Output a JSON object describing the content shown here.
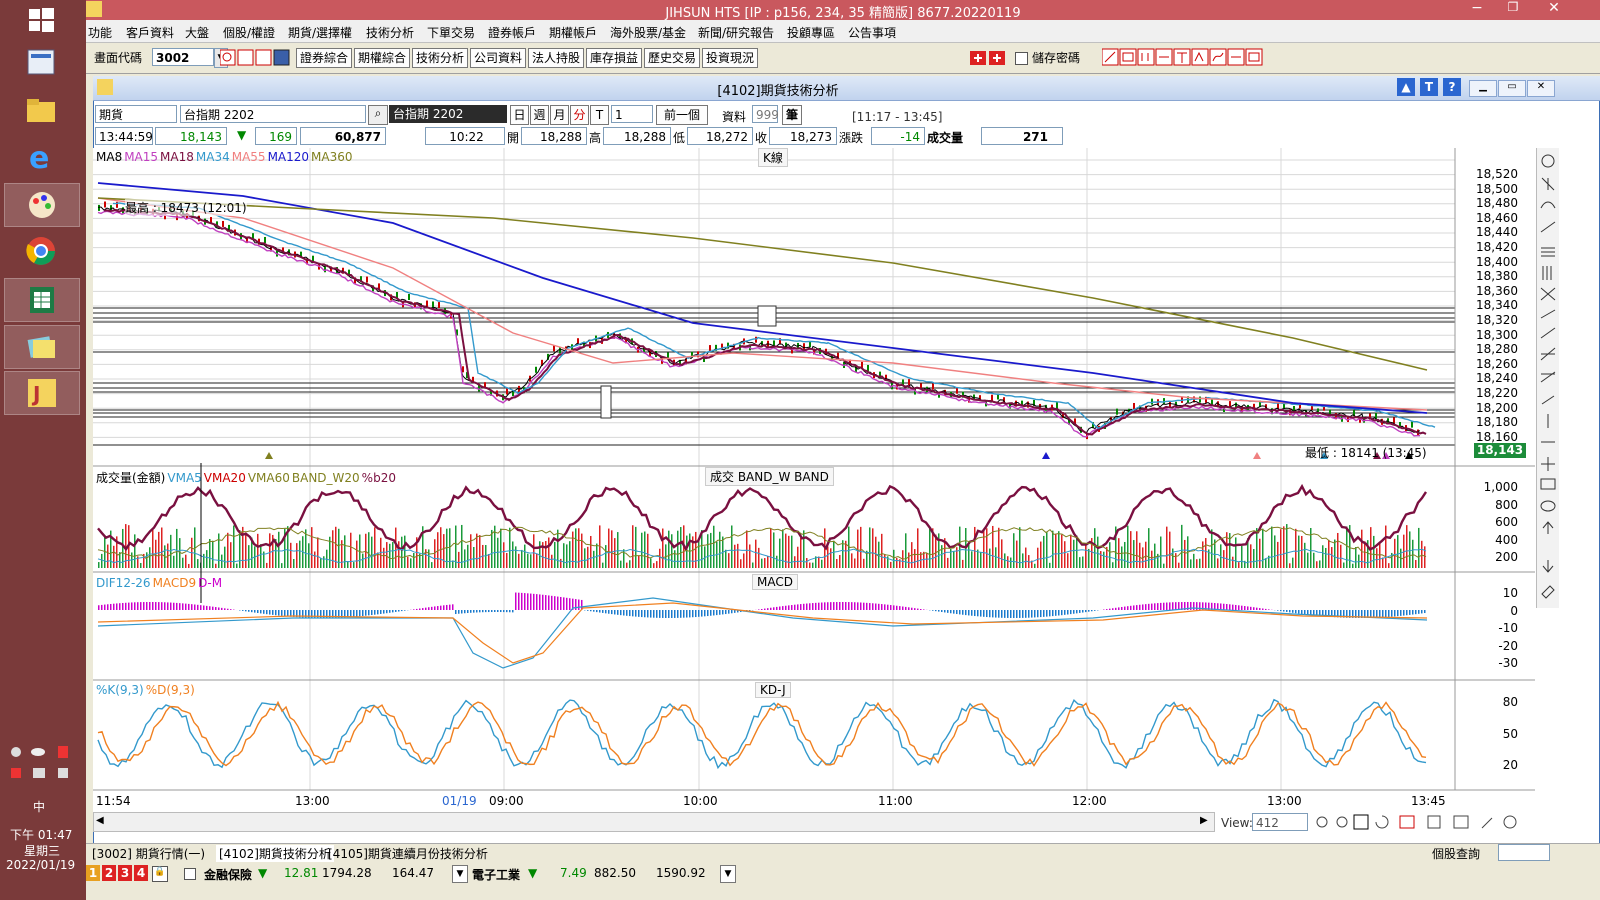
{
  "window": {
    "title": "JIHSUN HTS      [IP : p156, 234, 35 精簡版] 8677.20220119"
  },
  "menu": [
    "功能",
    "客戶資料",
    "大盤",
    "個股/權證",
    "期貨/選擇權",
    "技術分析",
    "下單交易",
    "證券帳戶",
    "期權帳戶",
    "海外股票/基金",
    "新聞/研究報告",
    "投顧專區",
    "公告事項"
  ],
  "toolbar": {
    "code_label": "畫面代碼",
    "code_value": "3002",
    "buttons": [
      "證券綜合",
      "期權綜合",
      "技術分析",
      "公司資料",
      "法人持股",
      "庫存損益",
      "歷史交易",
      "投資現況"
    ],
    "save_password": "儲存密碼"
  },
  "chart_window": {
    "title": "[4102]期貨技術分析",
    "product_type": "期貨",
    "product_name": "台指期 2202",
    "selected_product": "台指期 2202",
    "periods": [
      "日",
      "週",
      "月",
      "分",
      "T"
    ],
    "interval": "1",
    "prev_button": "前一個",
    "data_label": "資料",
    "data_count": "999",
    "count_unit": "筆",
    "session": "[11:17 - 13:45]",
    "view_label": "View:",
    "view_value": "412"
  },
  "quote": {
    "time": "13:44:59",
    "price": "18,143",
    "change_arrow": "▼",
    "change": "169",
    "volume_total": "60,877",
    "open_time": "10:22",
    "open_label": "開",
    "open": "18,288",
    "high_label": "高",
    "high": "18,288",
    "low_label": "低",
    "low": "18,272",
    "close_label": "收",
    "close": "18,273",
    "chg_label": "漲跌",
    "chg": "-14",
    "vol_label": "成交量",
    "vol": "271"
  },
  "panes": {
    "k": {
      "title": "K線",
      "legend": [
        {
          "name": "MA8",
          "color": "#000000"
        },
        {
          "name": "MA15",
          "color": "#c040c0"
        },
        {
          "name": "MA18",
          "color": "#7a1040"
        },
        {
          "name": "MA34",
          "color": "#3399cc"
        },
        {
          "name": "MA55",
          "color": "#f08080"
        },
        {
          "name": "MA120",
          "color": "#1a1acc"
        },
        {
          "name": "MA360",
          "color": "#808020"
        }
      ],
      "max_label": "最高 : 18473 (12:01)",
      "min_label": "最低 : 18141 (13:45)",
      "last_price": "18,143",
      "yticks": [
        "18,520",
        "18,500",
        "18,480",
        "18,460",
        "18,440",
        "18,420",
        "18,400",
        "18,380",
        "18,360",
        "18,340",
        "18,320",
        "18,300",
        "18,280",
        "18,260",
        "18,240",
        "18,220",
        "18,200",
        "18,180",
        "18,160"
      ]
    },
    "volume": {
      "title": "成交   BAND_W   BAND",
      "legend": [
        {
          "name": "成交量(金額)",
          "color": "#000000"
        },
        {
          "name": "VMA5",
          "color": "#3399cc"
        },
        {
          "name": "VMA20",
          "color": "#cc0000"
        },
        {
          "name": "VMA60",
          "color": "#808020"
        },
        {
          "name": "BAND_W20",
          "color": "#808020"
        },
        {
          "name": "%b20",
          "color": "#7a1040"
        }
      ],
      "yticks": [
        "1,000",
        "800",
        "600",
        "400",
        "200"
      ]
    },
    "macd": {
      "title": "MACD",
      "legend": [
        {
          "name": "DIF12-26",
          "color": "#3399cc"
        },
        {
          "name": "MACD9",
          "color": "#f08020"
        },
        {
          "name": "D-M",
          "color": "#cc00cc"
        }
      ],
      "yticks": [
        "10",
        "0",
        "-10",
        "-20",
        "-30"
      ]
    },
    "kd": {
      "title": "KD-J",
      "legend": [
        {
          "name": "%K(9,3)",
          "color": "#3399cc"
        },
        {
          "name": "%D(9,3)",
          "color": "#f08020"
        }
      ],
      "yticks": [
        "80",
        "50",
        "20"
      ]
    }
  },
  "xaxis": {
    "ticks": [
      "11:54",
      "13:00",
      "01/19",
      "09:00",
      "10:00",
      "11:00",
      "12:00",
      "13:00",
      "13:45"
    ]
  },
  "tabs": [
    "[3002] 期貨行情(一)",
    "[4102]期貨技術分析",
    "[4105]期貨連續月份技術分析"
  ],
  "tabs_right": "個股查詢",
  "bottom_ticker": {
    "pages": [
      "1",
      "2",
      "3",
      "4"
    ],
    "items": [
      {
        "name": "金融保險",
        "arrow": "▼",
        "change": "12.81",
        "price": "1794.28",
        "vol": "164.47"
      },
      {
        "name": "電子工業",
        "arrow": "▼",
        "change": "7.49",
        "price": "882.50",
        "vol": "1590.92"
      }
    ]
  },
  "desktop": {
    "clock_time": "下午 01:47",
    "clock_day": "星期三",
    "clock_date": "2022/01/19",
    "ime": "中"
  }
}
